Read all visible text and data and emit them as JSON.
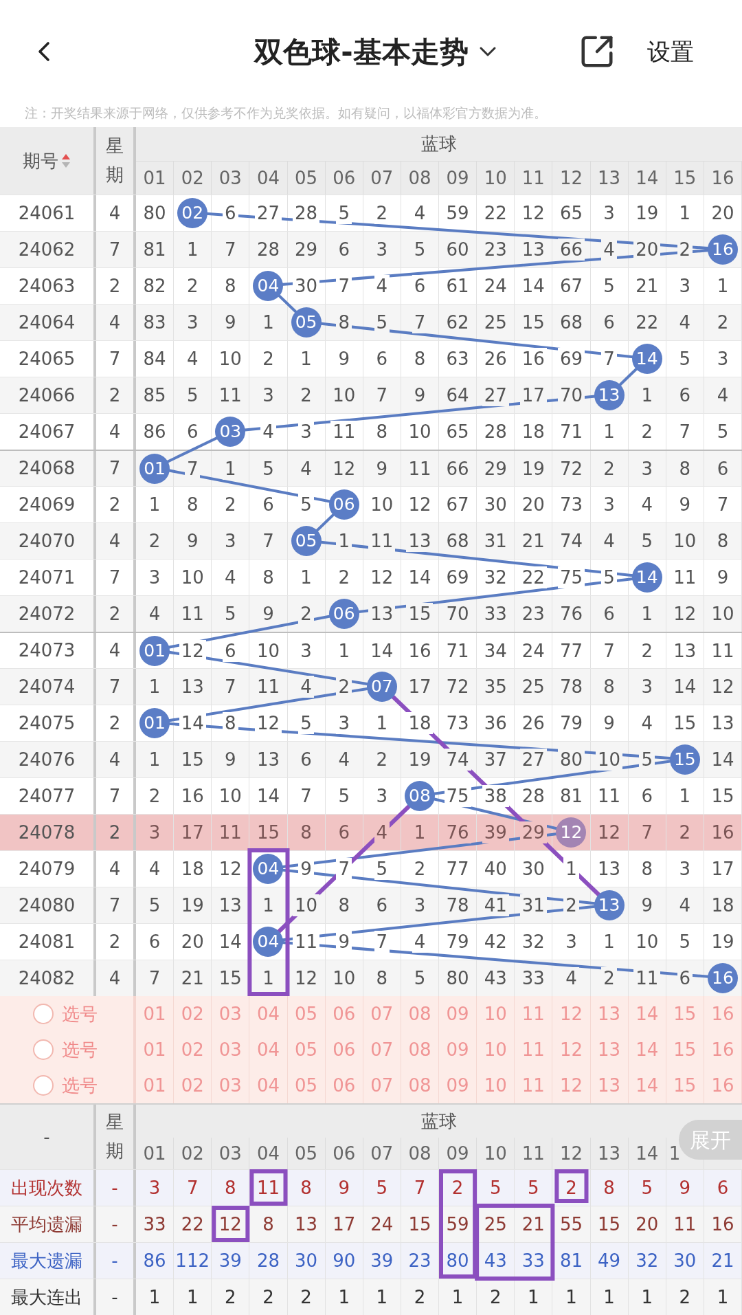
{
  "header": {
    "title": "双色球-基本走势",
    "settings": "设置"
  },
  "note": "注：开奖结果来源于网络，仅供参考不作为兑奖依据。如有疑问，以福体彩官方数据为准。",
  "table": {
    "period_header": "期号",
    "weekday_header": "星期",
    "group": "蓝球",
    "columns": [
      "01",
      "02",
      "03",
      "04",
      "05",
      "06",
      "07",
      "08",
      "09",
      "10",
      "11",
      "12",
      "13",
      "14",
      "15",
      "16"
    ],
    "rows": [
      {
        "period": "24061",
        "weekday": "4",
        "highlighted": false,
        "group_start": false,
        "cells": [
          "80",
          {
            "kind": "ball",
            "text": "02"
          },
          "6",
          "27",
          "28",
          "5",
          "2",
          "4",
          "59",
          "22",
          "12",
          "65",
          "3",
          "19",
          "1",
          "20"
        ]
      },
      {
        "period": "24062",
        "weekday": "7",
        "highlighted": false,
        "group_start": false,
        "cells": [
          "81",
          "1",
          "7",
          "28",
          "29",
          "6",
          "3",
          "5",
          "60",
          "23",
          "13",
          "66",
          "4",
          "20",
          "2",
          {
            "kind": "ball",
            "text": "16"
          }
        ]
      },
      {
        "period": "24063",
        "weekday": "2",
        "highlighted": false,
        "group_start": false,
        "cells": [
          "82",
          "2",
          "8",
          {
            "kind": "ball",
            "text": "04"
          },
          "30",
          "7",
          "4",
          "6",
          "61",
          "24",
          "14",
          "67",
          "5",
          "21",
          "3",
          "1"
        ]
      },
      {
        "period": "24064",
        "weekday": "4",
        "highlighted": false,
        "group_start": false,
        "cells": [
          "83",
          "3",
          "9",
          "1",
          {
            "kind": "ball",
            "text": "05"
          },
          "8",
          "5",
          "7",
          "62",
          "25",
          "15",
          "68",
          "6",
          "22",
          "4",
          "2"
        ]
      },
      {
        "period": "24065",
        "weekday": "7",
        "highlighted": false,
        "group_start": false,
        "cells": [
          "84",
          "4",
          "10",
          "2",
          "1",
          "9",
          "6",
          "8",
          "63",
          "26",
          "16",
          "69",
          "7",
          {
            "kind": "ball",
            "text": "14"
          },
          "5",
          "3"
        ]
      },
      {
        "period": "24066",
        "weekday": "2",
        "highlighted": false,
        "group_start": false,
        "cells": [
          "85",
          "5",
          "11",
          "3",
          "2",
          "10",
          "7",
          "9",
          "64",
          "27",
          "17",
          "70",
          {
            "kind": "ball",
            "text": "13"
          },
          "1",
          "6",
          "4"
        ]
      },
      {
        "period": "24067",
        "weekday": "4",
        "highlighted": false,
        "group_start": false,
        "cells": [
          "86",
          "6",
          {
            "kind": "ball",
            "text": "03"
          },
          "4",
          "3",
          "11",
          "8",
          "10",
          "65",
          "28",
          "18",
          "71",
          "1",
          "2",
          "7",
          "5"
        ]
      },
      {
        "period": "24068",
        "weekday": "7",
        "highlighted": false,
        "group_start": true,
        "cells": [
          {
            "kind": "ball",
            "text": "01"
          },
          "7",
          "1",
          "5",
          "4",
          "12",
          "9",
          "11",
          "66",
          "29",
          "19",
          "72",
          "2",
          "3",
          "8",
          "6"
        ]
      },
      {
        "period": "24069",
        "weekday": "2",
        "highlighted": false,
        "group_start": false,
        "cells": [
          "1",
          "8",
          "2",
          "6",
          "5",
          {
            "kind": "ball",
            "text": "06"
          },
          "10",
          "12",
          "67",
          "30",
          "20",
          "73",
          "3",
          "4",
          "9",
          "7"
        ]
      },
      {
        "period": "24070",
        "weekday": "4",
        "highlighted": false,
        "group_start": false,
        "cells": [
          "2",
          "9",
          "3",
          "7",
          {
            "kind": "ball",
            "text": "05"
          },
          "1",
          "11",
          "13",
          "68",
          "31",
          "21",
          "74",
          "4",
          "5",
          "10",
          "8"
        ]
      },
      {
        "period": "24071",
        "weekday": "7",
        "highlighted": false,
        "group_start": false,
        "cells": [
          "3",
          "10",
          "4",
          "8",
          "1",
          "2",
          "12",
          "14",
          "69",
          "32",
          "22",
          "75",
          "5",
          {
            "kind": "ball",
            "text": "14"
          },
          "11",
          "9"
        ]
      },
      {
        "period": "24072",
        "weekday": "2",
        "highlighted": false,
        "group_start": false,
        "cells": [
          "4",
          "11",
          "5",
          "9",
          "2",
          {
            "kind": "ball",
            "text": "06"
          },
          "13",
          "15",
          "70",
          "33",
          "23",
          "76",
          "6",
          "1",
          "12",
          "10"
        ]
      },
      {
        "period": "24073",
        "weekday": "4",
        "highlighted": false,
        "group_start": true,
        "cells": [
          {
            "kind": "ball",
            "text": "01"
          },
          "12",
          "6",
          "10",
          "3",
          "1",
          "14",
          "16",
          "71",
          "34",
          "24",
          "77",
          "7",
          "2",
          "13",
          "11"
        ]
      },
      {
        "period": "24074",
        "weekday": "7",
        "highlighted": false,
        "group_start": false,
        "cells": [
          "1",
          "13",
          "7",
          "11",
          "4",
          "2",
          {
            "kind": "ball",
            "text": "07"
          },
          "17",
          "72",
          "35",
          "25",
          "78",
          "8",
          "3",
          "14",
          "12"
        ]
      },
      {
        "period": "24075",
        "weekday": "2",
        "highlighted": false,
        "group_start": false,
        "cells": [
          {
            "kind": "ball",
            "text": "01"
          },
          "14",
          "8",
          "12",
          "5",
          "3",
          "1",
          "18",
          "73",
          "36",
          "26",
          "79",
          "9",
          "4",
          "15",
          "13"
        ]
      },
      {
        "period": "24076",
        "weekday": "4",
        "highlighted": false,
        "group_start": false,
        "cells": [
          "1",
          "15",
          "9",
          "13",
          "6",
          "4",
          "2",
          "19",
          "74",
          "37",
          "27",
          "80",
          "10",
          "5",
          {
            "kind": "ball",
            "text": "15"
          },
          "14"
        ]
      },
      {
        "period": "24077",
        "weekday": "7",
        "highlighted": false,
        "group_start": false,
        "cells": [
          "2",
          "16",
          "10",
          "14",
          "7",
          "5",
          "3",
          {
            "kind": "ball",
            "text": "08"
          },
          "75",
          "38",
          "28",
          "81",
          "11",
          "6",
          "1",
          "15"
        ]
      },
      {
        "period": "24078",
        "weekday": "2",
        "highlighted": true,
        "group_start": false,
        "cells": [
          "3",
          "17",
          "11",
          "15",
          "8",
          "6",
          "4",
          "1",
          "76",
          "39",
          "29",
          {
            "kind": "ball",
            "text": "12"
          },
          "12",
          "7",
          "2",
          "16"
        ]
      },
      {
        "period": "24079",
        "weekday": "4",
        "highlighted": false,
        "group_start": false,
        "cells": [
          "4",
          "18",
          "12",
          {
            "kind": "ball",
            "text": "04"
          },
          "9",
          "7",
          "5",
          "2",
          "77",
          "40",
          "30",
          "1",
          "13",
          "8",
          "3",
          "17"
        ]
      },
      {
        "period": "24080",
        "weekday": "7",
        "highlighted": false,
        "group_start": false,
        "cells": [
          "5",
          "19",
          "13",
          "1",
          "10",
          "8",
          "6",
          "3",
          "78",
          "41",
          "31",
          "2",
          {
            "kind": "ball",
            "text": "13"
          },
          "9",
          "4",
          "18"
        ]
      },
      {
        "period": "24081",
        "weekday": "2",
        "highlighted": false,
        "group_start": false,
        "cells": [
          "6",
          "20",
          "14",
          {
            "kind": "ball",
            "text": "04"
          },
          "11",
          "9",
          "7",
          "4",
          "79",
          "42",
          "32",
          "3",
          "1",
          "10",
          "5",
          "19"
        ]
      },
      {
        "period": "24082",
        "weekday": "4",
        "highlighted": false,
        "group_start": false,
        "cells": [
          "7",
          "21",
          "15",
          "1",
          "12",
          "10",
          "8",
          "5",
          "80",
          "43",
          "33",
          "4",
          "2",
          "11",
          "6",
          {
            "kind": "ball",
            "text": "16"
          }
        ]
      }
    ]
  },
  "pick_rows": [
    {
      "label": "选号",
      "checked": false,
      "numbers": [
        "01",
        "02",
        "03",
        "04",
        "05",
        "06",
        "07",
        "08",
        "09",
        "10",
        "11",
        "12",
        "13",
        "14",
        "15",
        "16"
      ]
    },
    {
      "label": "选号",
      "checked": false,
      "numbers": [
        "01",
        "02",
        "03",
        "04",
        "05",
        "06",
        "07",
        "08",
        "09",
        "10",
        "11",
        "12",
        "13",
        "14",
        "15",
        "16"
      ]
    },
    {
      "label": "选号",
      "checked": false,
      "numbers": [
        "01",
        "02",
        "03",
        "04",
        "05",
        "06",
        "07",
        "08",
        "09",
        "10",
        "11",
        "12",
        "13",
        "14",
        "15",
        "16"
      ]
    }
  ],
  "stats": {
    "period_header": "-",
    "weekday_header": "星期",
    "group": "蓝球",
    "columns": [
      "01",
      "02",
      "03",
      "04",
      "05",
      "06",
      "07",
      "08",
      "09",
      "10",
      "11",
      "12",
      "13",
      "14",
      "1"
    ],
    "expand_button": "展开",
    "rows": [
      {
        "label": "出现次数",
        "color": "#b2302f",
        "weekday": "-",
        "values": [
          "3",
          "7",
          "8",
          "11",
          "8",
          "9",
          "5",
          "7",
          "2",
          "5",
          "5",
          "2",
          "8",
          "5",
          "9",
          "6"
        ]
      },
      {
        "label": "平均遗漏",
        "color": "#8e3b34",
        "weekday": "-",
        "values": [
          "33",
          "22",
          "12",
          "8",
          "13",
          "17",
          "24",
          "15",
          "59",
          "25",
          "21",
          "55",
          "15",
          "20",
          "11",
          "16"
        ]
      },
      {
        "label": "最大遗漏",
        "color": "#3d63c4",
        "weekday": "-",
        "values": [
          "86",
          "112",
          "39",
          "28",
          "30",
          "90",
          "39",
          "23",
          "80",
          "43",
          "33",
          "81",
          "49",
          "32",
          "30",
          "21"
        ]
      },
      {
        "label": "最大连出",
        "color": "#333333",
        "weekday": "-",
        "values": [
          "1",
          "1",
          "2",
          "2",
          "2",
          "1",
          "1",
          "2",
          "1",
          "2",
          "1",
          "1",
          "1",
          "1",
          "2",
          "1"
        ]
      }
    ]
  }
}
